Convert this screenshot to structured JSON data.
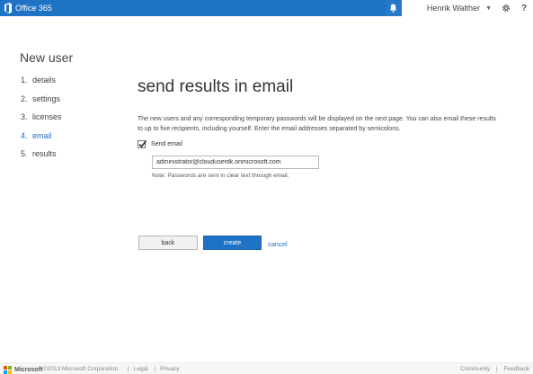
{
  "header": {
    "brand": "Office 365",
    "user_name": "Henrik Walther",
    "icons": [
      "bell-icon",
      "chevron-down-icon",
      "gear-icon",
      "help-icon"
    ],
    "help_label": "?",
    "colors": {
      "bar": "#1f73c4",
      "accent": "#1f6fc0"
    }
  },
  "wizard": {
    "title": "New user",
    "steps": [
      {
        "num": "1.",
        "label": "details",
        "active": false
      },
      {
        "num": "2.",
        "label": "settings",
        "active": false
      },
      {
        "num": "3.",
        "label": "licenses",
        "active": false
      },
      {
        "num": "4.",
        "label": "email",
        "active": true
      },
      {
        "num": "5.",
        "label": "results",
        "active": false
      }
    ]
  },
  "main": {
    "title": "send results in email",
    "description": "The new users and any corresponding temporary passwords will be displayed on the next page. You can also email these results to up to five recipients, including yourself. Enter the email addresses separated by semicolons.",
    "send_email_label": "Send email",
    "send_email_checked": true,
    "email_value": "administrator@clouduserdk.onmicrosoft.com",
    "note": "Note: Passwords are sent in clear text through email."
  },
  "actions": {
    "back_label": "back",
    "create_label": "create",
    "cancel_label": "cancel"
  },
  "footer": {
    "brand": "Microsoft",
    "copyright": "©2013 Microsoft Corporation",
    "legal": "Legal",
    "privacy": "Privacy",
    "community": "Community",
    "feedback": "Feedback",
    "separator": "|"
  }
}
